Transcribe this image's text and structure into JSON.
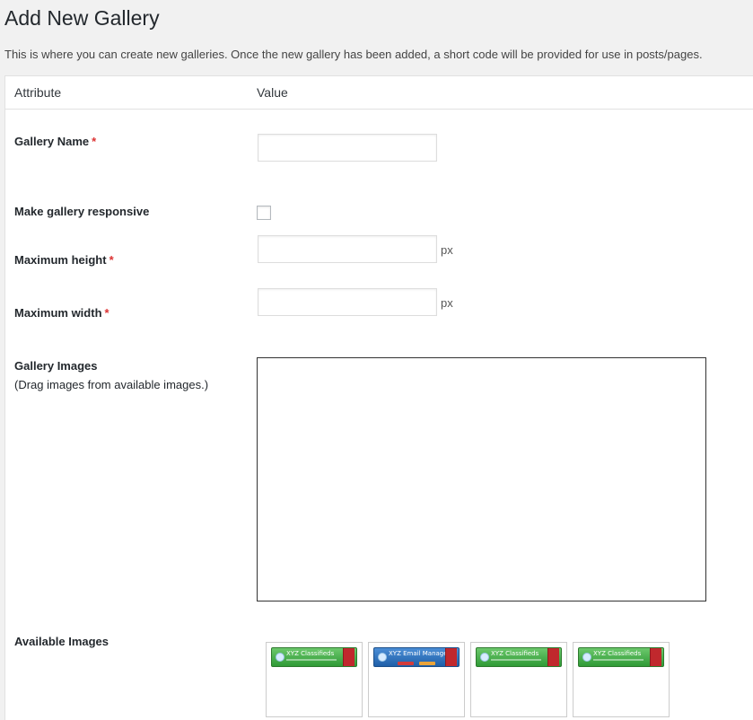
{
  "page": {
    "title": "Add New Gallery",
    "description": "This is where you can create new galleries. Once the new gallery has been added, a short code will be provided for use in posts/pages."
  },
  "table": {
    "header": {
      "attribute": "Attribute",
      "value": "Value"
    }
  },
  "fields": {
    "gallery_name": {
      "label": "Gallery Name",
      "required_mark": "*",
      "value": ""
    },
    "responsive": {
      "label": "Make gallery responsive",
      "checked": false
    },
    "max_height": {
      "label": "Maximum height",
      "required_mark": "*",
      "value": "",
      "unit": "px"
    },
    "max_width": {
      "label": "Maximum width",
      "required_mark": "*",
      "value": "",
      "unit": "px"
    },
    "gallery_images": {
      "label": "Gallery Images",
      "hint": "(Drag images from available images.)"
    },
    "available_images": {
      "label": "Available Images",
      "items": [
        {
          "banner_text": "XYZ Classifieds",
          "color": "#2f9a36"
        },
        {
          "banner_text": "XYZ Email Manager",
          "color": "#1f5fa8"
        },
        {
          "banner_text": "XYZ Classifieds",
          "color": "#2f9a36"
        },
        {
          "banner_text": "XYZ Classifieds",
          "color": "#2f9a36"
        }
      ]
    }
  },
  "colors": {
    "required": "#dc3232",
    "background": "#f1f1f1"
  }
}
